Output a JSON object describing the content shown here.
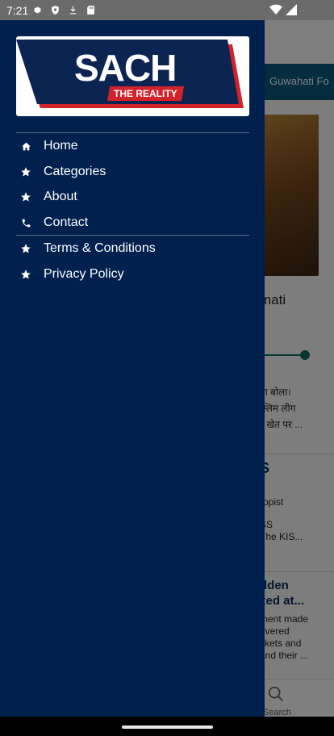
{
  "status_bar": {
    "time": "7:21"
  },
  "background": {
    "ticker_text": "Guwahati Fo",
    "headline_fragment": "mati",
    "hindi_lines": [
      "ना बोला।",
      "स्लिम लीग",
      "र खेत पर ..."
    ],
    "story_title_fragment": "S",
    "story_lines": [
      "ropist",
      "SS",
      "The KIS..."
    ],
    "story2_title": [
      "dden",
      "zed at..."
    ],
    "story2_lines": [
      "ment made",
      "overed",
      "ckets and",
      "and their ..."
    ],
    "search_label": "Search"
  },
  "drawer": {
    "logo": {
      "title": "SACH",
      "tagline": "THE REALITY",
      "colors": {
        "navy": "#0b2452",
        "red": "#d3232a"
      }
    },
    "menu": [
      {
        "label": "Home",
        "icon": "home-icon"
      },
      {
        "label": "Categories",
        "icon": "star-icon"
      },
      {
        "label": "About",
        "icon": "star-icon"
      },
      {
        "label": "Contact",
        "icon": "phone-icon"
      },
      {
        "label": "Terms & Conditions",
        "icon": "star-icon"
      },
      {
        "label": "Privacy Policy",
        "icon": "star-icon"
      }
    ],
    "colors": {
      "background": "#00214d",
      "text": "#ffffff",
      "divider": "#5a6c86"
    }
  }
}
